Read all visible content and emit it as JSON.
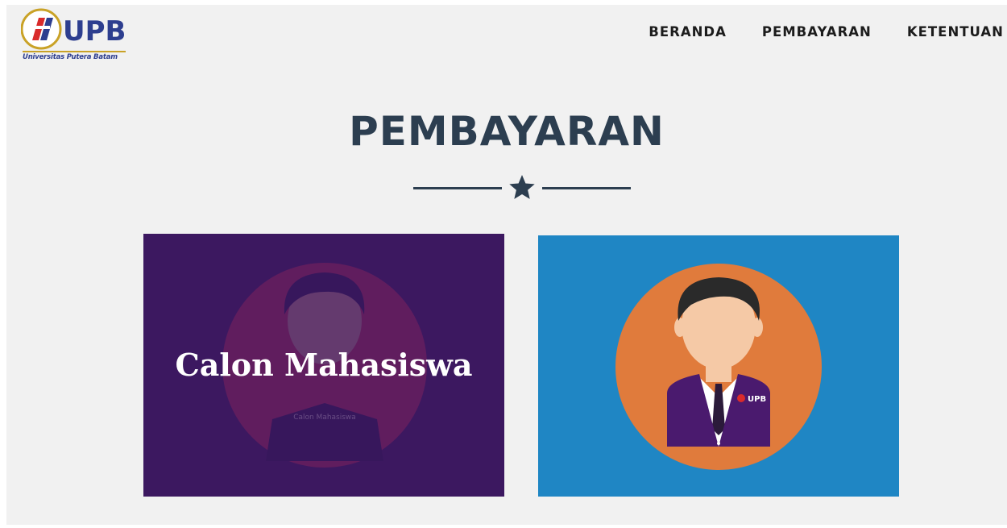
{
  "header": {
    "logo": {
      "brand": "UPB",
      "tagline": "Universitas Putera Batam",
      "colors": {
        "blue": "#2d3e8f",
        "red": "#d92b2b",
        "gold": "#c9a227"
      }
    },
    "nav": [
      {
        "label": "BERANDA"
      },
      {
        "label": "PEMBAYARAN"
      },
      {
        "label": "KETENTUAN"
      }
    ]
  },
  "main": {
    "title": "PEMBAYARAN",
    "divider_icon": "star-icon",
    "cards": [
      {
        "caption": "Calon Mahasiswa",
        "overlay_text": "Calon Mahasiswa",
        "state": "hover-overlay",
        "background": "#3c1860",
        "illustration": "student-avatar-icon"
      },
      {
        "caption": "",
        "jacket_badge": "UPB",
        "background": "#1f86c4",
        "circle_color": "#e07b3c",
        "illustration": "student-avatar-icon"
      }
    ]
  }
}
